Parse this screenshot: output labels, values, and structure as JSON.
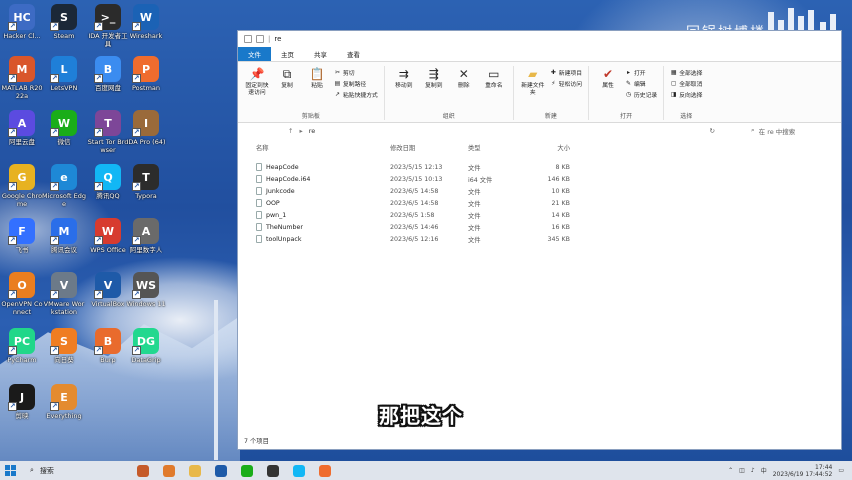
{
  "wallpaper_title": "回锅树博楼",
  "desktop_icons": [
    {
      "label": "Hacker Cl...",
      "color": "#3d6bc4",
      "glyph": "HC"
    },
    {
      "label": "Steam",
      "color": "#1b2838",
      "glyph": "S"
    },
    {
      "label": "IDA 开发者工具",
      "color": "#2b2b2b",
      "glyph": ">_"
    },
    {
      "label": "Wireshark",
      "color": "#1b62b5",
      "glyph": "W"
    },
    {
      "label": "MATLAB R2022a",
      "color": "#d9562b",
      "glyph": "M"
    },
    {
      "label": "LetsVPN",
      "color": "#1f7fd8",
      "glyph": "L"
    },
    {
      "label": "百度网盘",
      "color": "#3b8cf0",
      "glyph": "B"
    },
    {
      "label": "Postman",
      "color": "#ef6c2e",
      "glyph": "P"
    },
    {
      "label": "阿里云盘",
      "color": "#5b4be0",
      "glyph": "A"
    },
    {
      "label": "微信",
      "color": "#1aad19",
      "glyph": "W"
    },
    {
      "label": "Start Tor Browser",
      "color": "#7d4698",
      "glyph": "T"
    },
    {
      "label": "IDA Pro (64)",
      "color": "#9a6a3a",
      "glyph": "I"
    },
    {
      "label": "Google Chrome",
      "color": "#e7b221",
      "glyph": "G"
    },
    {
      "label": "Microsoft Edge",
      "color": "#1e88d6",
      "glyph": "e"
    },
    {
      "label": "腾讯QQ",
      "color": "#12b7f5",
      "glyph": "Q"
    },
    {
      "label": "Typora",
      "color": "#2c2c2c",
      "glyph": "T"
    },
    {
      "label": "飞书",
      "color": "#3370ff",
      "glyph": "F"
    },
    {
      "label": "腾讯会议",
      "color": "#2a6ee9",
      "glyph": "M"
    },
    {
      "label": "WPS Office",
      "color": "#d73b2f",
      "glyph": "W"
    },
    {
      "label": "阿里数字人",
      "color": "#6a6a6a",
      "glyph": "A"
    },
    {
      "label": "OpenVPN Connect",
      "color": "#ea7e20",
      "glyph": "O"
    },
    {
      "label": "VMware Workstation",
      "color": "#6c7a89",
      "glyph": "V"
    },
    {
      "label": "VirtualBox",
      "color": "#1e5aa8",
      "glyph": "V"
    },
    {
      "label": "Windows 11",
      "color": "#555555",
      "glyph": "WS"
    },
    {
      "label": "PyCharm",
      "color": "#21d789",
      "glyph": "PC"
    },
    {
      "label": "向日葵",
      "color": "#ef7d22",
      "glyph": "S"
    },
    {
      "label": "Burp",
      "color": "#e96b2d",
      "glyph": "B"
    },
    {
      "label": "DataGrip",
      "color": "#22d88f",
      "glyph": "DG"
    },
    {
      "label": "剪映",
      "color": "#1a1a1a",
      "glyph": "J"
    },
    {
      "label": "Everything",
      "color": "#e48b2f",
      "glyph": "E"
    }
  ],
  "explorer": {
    "title": "re",
    "tabs": [
      "文件",
      "主页",
      "共享",
      "查看"
    ],
    "ribbon": {
      "clipboard": {
        "name": "剪贴板",
        "pin": "固定到快速访问",
        "copy": "复制",
        "paste": "粘贴",
        "cut": "剪切",
        "copy_path": "复制路径",
        "paste_shortcut": "粘贴快捷方式"
      },
      "organize": {
        "name": "组织",
        "move_to": "移动到",
        "copy_to": "复制到",
        "delete": "删除",
        "rename": "重命名"
      },
      "new": {
        "name": "新建",
        "new_folder": "新建文件夹",
        "new_item": "新建项目",
        "easy_access": "轻松访问"
      },
      "open": {
        "name": "打开",
        "properties": "属性",
        "open": "打开",
        "edit": "编辑",
        "history": "历史记录"
      },
      "select": {
        "name": "选择",
        "select_all": "全部选择",
        "select_none": "全部取消",
        "invert": "反向选择"
      }
    },
    "address": {
      "path": "re",
      "search_placeholder": "在 re 中搜索"
    },
    "columns": {
      "name": "名称",
      "date": "修改日期",
      "type": "类型",
      "size": "大小"
    },
    "files": [
      {
        "name": "HeapCode",
        "date": "2023/5/15 12:13",
        "type": "文件",
        "size": "8 KB"
      },
      {
        "name": "HeapCode.i64",
        "date": "2023/5/15 10:13",
        "type": "i64 文件",
        "size": "146 KB"
      },
      {
        "name": "Junkcode",
        "date": "2023/6/5 14:58",
        "type": "文件",
        "size": "10 KB"
      },
      {
        "name": "OOP",
        "date": "2023/6/5 14:58",
        "type": "文件",
        "size": "21 KB"
      },
      {
        "name": "pwn_1",
        "date": "2023/6/5 1:58",
        "type": "文件",
        "size": "14 KB"
      },
      {
        "name": "TheNumber",
        "date": "2023/6/5 14:46",
        "type": "文件",
        "size": "16 KB"
      },
      {
        "name": "toolUnpack",
        "date": "2023/6/5 12:16",
        "type": "文件",
        "size": "345 KB"
      }
    ],
    "status": "7 个项目"
  },
  "subtitle": "那把这个",
  "taskbar": {
    "search_label": "搜索",
    "time": "17:44",
    "date": "2023/6/19 17:44:52"
  }
}
